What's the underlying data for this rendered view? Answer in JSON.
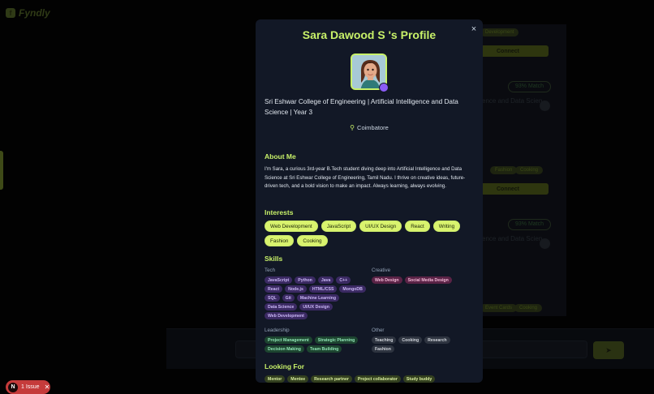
{
  "app": {
    "name": "Fyndly"
  },
  "background": {
    "pills": [
      "Development",
      "Fashion",
      "Cooking",
      "Event Cards",
      "Cooking"
    ],
    "connect_label": "Connect",
    "match_label": "93% Match",
    "college_partial": "ence and Data Scien"
  },
  "issue": {
    "badge": "N",
    "label": "1 Issue"
  },
  "modal": {
    "close_glyph": "×",
    "title": "Sara Dawood S 's Profile",
    "college": "Sri Eshwar College of Engineering | Artificial Intelligence and Data Science | Year 3",
    "location": "Coimbatore",
    "about_title": "About Me",
    "about_text": "I'm Sara, a curious 3rd-year B.Tech student diving deep into Artificial Intelligence and Data Science at Sri Eshwar College of Engineering, Tamil Nadu. I thrive on creative ideas, future-driven tech, and a bold vision to make an impact. Always learning, always evolving.",
    "interests_title": "Interests",
    "interests": [
      "Web Development",
      "JavaScript",
      "UI/UX Design",
      "React",
      "Writing",
      "Fashion",
      "Cooking"
    ],
    "skills_title": "Skills",
    "skills": {
      "tech_label": "Tech",
      "tech": [
        "JavaScript",
        "Python",
        "Java",
        "C++",
        "React",
        "Node.js",
        "HTML/CSS",
        "MongoDB",
        "SQL",
        "Git",
        "Machine Learning",
        "Data Science",
        "UI/UX Design",
        "Web Development"
      ],
      "creative_label": "Creative",
      "creative": [
        "Web Design",
        "Social Media Design"
      ],
      "leadership_label": "Leadership",
      "leadership": [
        "Project Management",
        "Strategic Planning",
        "Decision Making",
        "Team Building"
      ],
      "other_label": "Other",
      "other": [
        "Teaching",
        "Cooking",
        "Research",
        "Fashion"
      ]
    },
    "looking_title": "Looking For",
    "looking": [
      "Mentor",
      "Mentee",
      "Research partner",
      "Project collaborator",
      "Study buddy"
    ]
  },
  "colors": {
    "accent": "#c8f169",
    "modal_bg": "#121826",
    "verify": "#8b5cf6"
  },
  "icons": {
    "close": "close-icon",
    "location": "map-pin-icon",
    "logo": "logo-icon"
  }
}
